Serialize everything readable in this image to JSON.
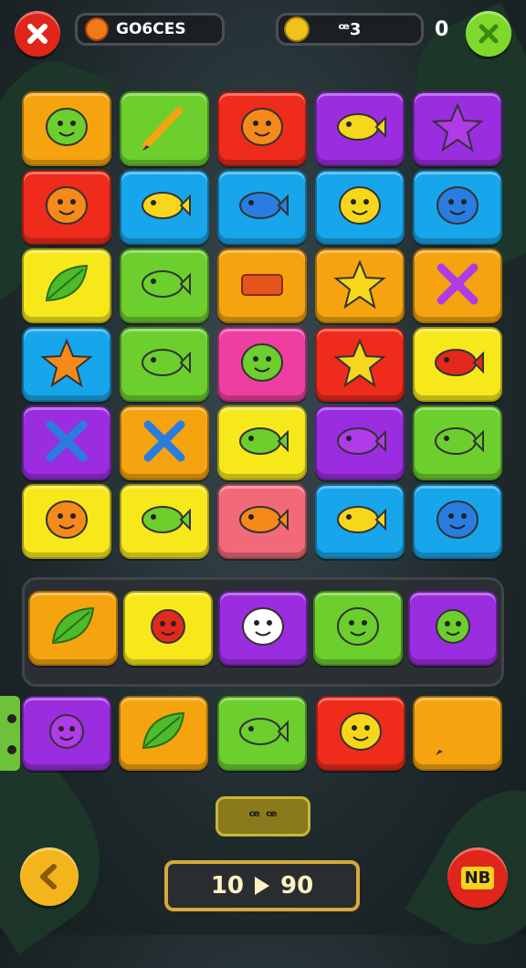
{
  "topbar": {
    "player_name": "GO6CES",
    "coins_value": "ꟹ3",
    "score": "0"
  },
  "board": {
    "rows": [
      [
        {
          "color": "#f5a40f",
          "icon": "green-blob-face-icon"
        },
        {
          "color": "#6ccf2d",
          "icon": "pencil-icon"
        },
        {
          "color": "#ef2b1c",
          "icon": "orange-smiley-face-icon"
        },
        {
          "color": "#9b2de0",
          "icon": "yellow-fish-icon"
        },
        {
          "color": "#9b2de0",
          "icon": "purple-star-blob-icon"
        }
      ],
      [
        {
          "color": "#ef2b1c",
          "icon": "sun-face-icon"
        },
        {
          "color": "#17a6ec",
          "icon": "yellow-fish-eye-icon"
        },
        {
          "color": "#17a6ec",
          "icon": "blue-fish-face-icon"
        },
        {
          "color": "#17a6ec",
          "icon": "yellow-blob-face-icon"
        },
        {
          "color": "#17a6ec",
          "icon": "blue-bomb-icon"
        }
      ],
      [
        {
          "color": "#f7e81c",
          "icon": "green-leaf-icon"
        },
        {
          "color": "#6ccf2d",
          "icon": "green-fish-icon"
        },
        {
          "color": "#f5a40f",
          "icon": "orange-brick-icon"
        },
        {
          "color": "#f5a40f",
          "icon": "yellow-star-icon"
        },
        {
          "color": "#f5a40f",
          "icon": "purple-cross-icon"
        }
      ],
      [
        {
          "color": "#17a6ec",
          "icon": "orange-starfish-icon"
        },
        {
          "color": "#6ccf2d",
          "icon": "green-fish-face-icon"
        },
        {
          "color": "#ee3fa0",
          "icon": "green-blob-face-icon"
        },
        {
          "color": "#ef2b1c",
          "icon": "yellow-star-icon"
        },
        {
          "color": "#f7e81c",
          "icon": "red-bird-icon"
        }
      ],
      [
        {
          "color": "#9b2de0",
          "icon": "blue-cross-icon"
        },
        {
          "color": "#f5a40f",
          "icon": "blue-cross-icon"
        },
        {
          "color": "#f7e81c",
          "icon": "green-fish-face-icon"
        },
        {
          "color": "#9b2de0",
          "icon": "purple-dinosaur-icon"
        },
        {
          "color": "#6ccf2d",
          "icon": "green-lizard-icon"
        }
      ],
      [
        {
          "color": "#f7e81c",
          "icon": "orange-face-hat-icon"
        },
        {
          "color": "#f7e81c",
          "icon": "green-fish-icon"
        },
        {
          "color": "#f26a7a",
          "icon": "orange-fish-icon"
        },
        {
          "color": "#17a6ec",
          "icon": "yellow-fish-eye-icon"
        },
        {
          "color": "#17a6ec",
          "icon": "blue-blob-icon"
        }
      ]
    ]
  },
  "tray": {
    "tiles": [
      {
        "color": "#f5a40f",
        "icon": "green-leaf-bird-icon"
      },
      {
        "color": "#f7e81c",
        "icon": "red-monster-face-icon"
      },
      {
        "color": "#9b2de0",
        "icon": "ghost-face-icon"
      },
      {
        "color": "#6ccf2d",
        "icon": "green-bush-icon"
      },
      {
        "color": "#9b2de0",
        "icon": "green-spiky-face-icon"
      }
    ]
  },
  "bottom_row": {
    "tiles": [
      {
        "color": "#9b2de0",
        "icon": "purple-flower-icon"
      },
      {
        "color": "#f5a40f",
        "icon": "green-leaf-icon"
      },
      {
        "color": "#6ccf2d",
        "icon": "green-fish-face-icon"
      },
      {
        "color": "#ef2b1c",
        "icon": "yellow-smiley-face-icon"
      },
      {
        "color": "#f5a40f",
        "icon": "pencil-icon"
      }
    ]
  },
  "counter": {
    "label": "ꟹ ꟹ"
  },
  "progress": {
    "current": "10",
    "target": "90"
  },
  "buttons": {
    "close": {
      "color": "#e0251b"
    },
    "confirm": {
      "color": "#7fd82c"
    },
    "back": {
      "color": "#f3b51b"
    },
    "menu": {
      "color": "#e0251b",
      "label": "NB"
    }
  }
}
